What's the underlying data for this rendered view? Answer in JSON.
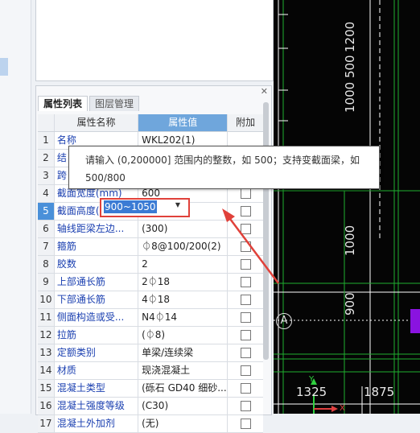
{
  "tabs": [
    {
      "label": "属性列表"
    },
    {
      "label": "图层管理"
    }
  ],
  "header": {
    "name": "属性名称",
    "value": "属性值",
    "add": "附加"
  },
  "rows": [
    {
      "num": "1",
      "name": "名称",
      "value": "WKL202(1)"
    },
    {
      "num": "2",
      "name": "结",
      "value": ""
    },
    {
      "num": "3",
      "name": "跨",
      "value": ""
    },
    {
      "num": "4",
      "name": "截面宽度(mm)",
      "value": "600"
    },
    {
      "num": "5",
      "name": "截面高度(mm)",
      "value": "900~1050"
    },
    {
      "num": "6",
      "name": "轴线距梁左边...",
      "value": "(300)"
    },
    {
      "num": "7",
      "name": "箍筋",
      "value": "⏀8@100/200(2)"
    },
    {
      "num": "8",
      "name": "胶数",
      "value": "2"
    },
    {
      "num": "9",
      "name": "上部通长筋",
      "value": "2⏀18"
    },
    {
      "num": "10",
      "name": "下部通长筋",
      "value": "4⏀18"
    },
    {
      "num": "11",
      "name": "侧面构造或受...",
      "value": "N4⏀14"
    },
    {
      "num": "12",
      "name": "拉筋",
      "value": "(⏀8)"
    },
    {
      "num": "13",
      "name": "定额类别",
      "value": "单梁/连续梁"
    },
    {
      "num": "14",
      "name": "材质",
      "value": "现浇混凝土"
    },
    {
      "num": "15",
      "name": "混凝土类型",
      "value": "(砾石 GD40 细砂..."
    },
    {
      "num": "16",
      "name": "混凝土强度等级",
      "value": "(C30)"
    },
    {
      "num": "17",
      "name": "混凝土外加剂",
      "value": "(无)"
    }
  ],
  "tooltip": {
    "line1": "请输入 (0,200000] 范围内的整数，如 500；支持变截面梁，如",
    "line2": "500/800"
  },
  "canvas": {
    "dim_top": "1200",
    "dim_mid": "1000 500",
    "dim_low": "1000",
    "dim_bottom": "900",
    "axis_label": "A",
    "bottom_left": "1325",
    "bottom_right": "1875",
    "axis_y": "Y",
    "axis_x": "X"
  },
  "colors": {
    "accent": "#6fa6dc",
    "highlight": "#e0413a",
    "canvas_bg": "#050505",
    "grid_green": "#1fae2e"
  }
}
